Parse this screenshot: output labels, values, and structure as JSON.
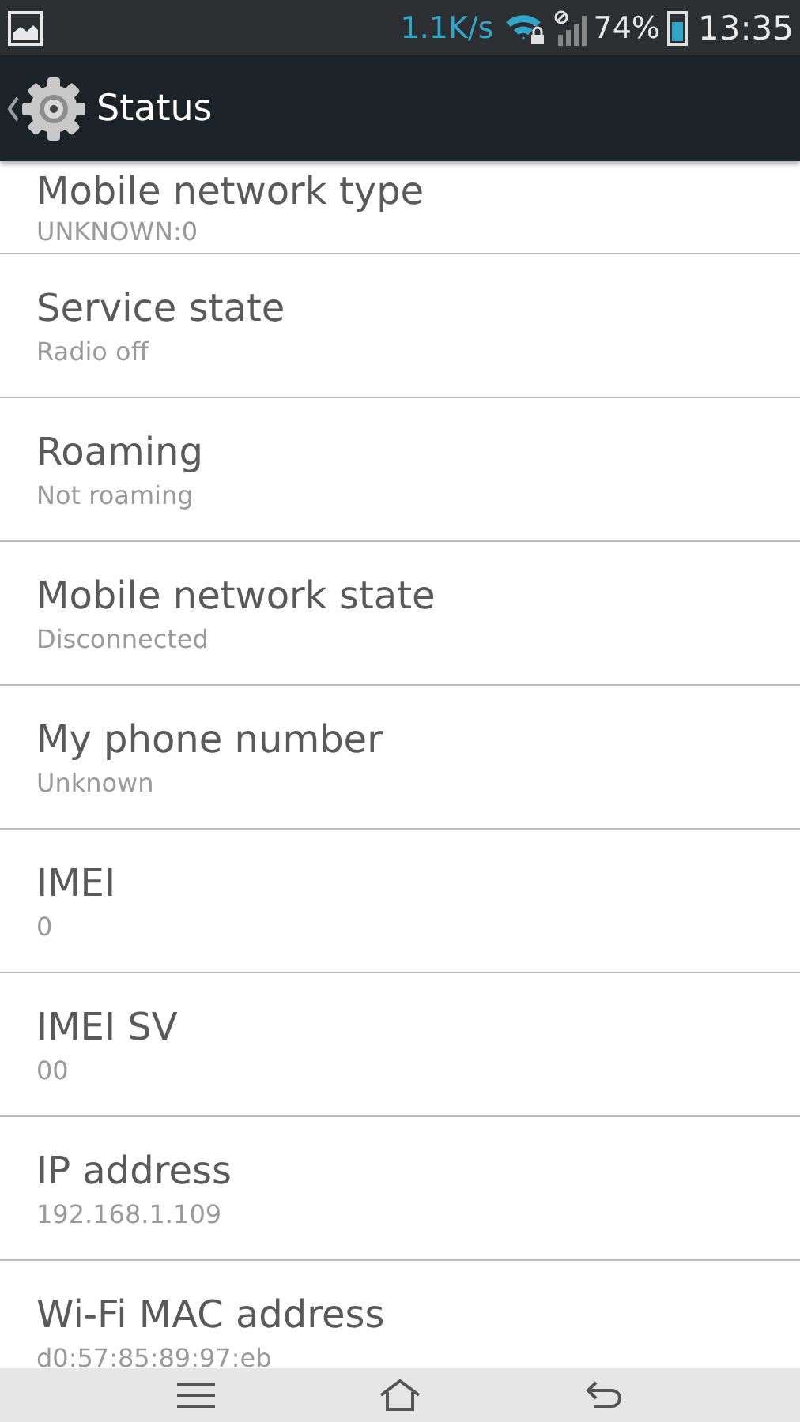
{
  "status_bar": {
    "speed": "1.1K/s",
    "battery_percent": "74%",
    "time": "13:35"
  },
  "action_bar": {
    "title": "Status"
  },
  "items": [
    {
      "title": "Mobile network type",
      "value": "UNKNOWN:0"
    },
    {
      "title": "Service state",
      "value": "Radio off"
    },
    {
      "title": "Roaming",
      "value": "Not roaming"
    },
    {
      "title": "Mobile network state",
      "value": "Disconnected"
    },
    {
      "title": "My phone number",
      "value": "Unknown"
    },
    {
      "title": "IMEI",
      "value": "0"
    },
    {
      "title": "IMEI SV",
      "value": "00"
    },
    {
      "title": "IP address",
      "value": "192.168.1.109"
    },
    {
      "title": "Wi-Fi MAC address",
      "value": "d0:57:85:89:97:eb"
    }
  ]
}
